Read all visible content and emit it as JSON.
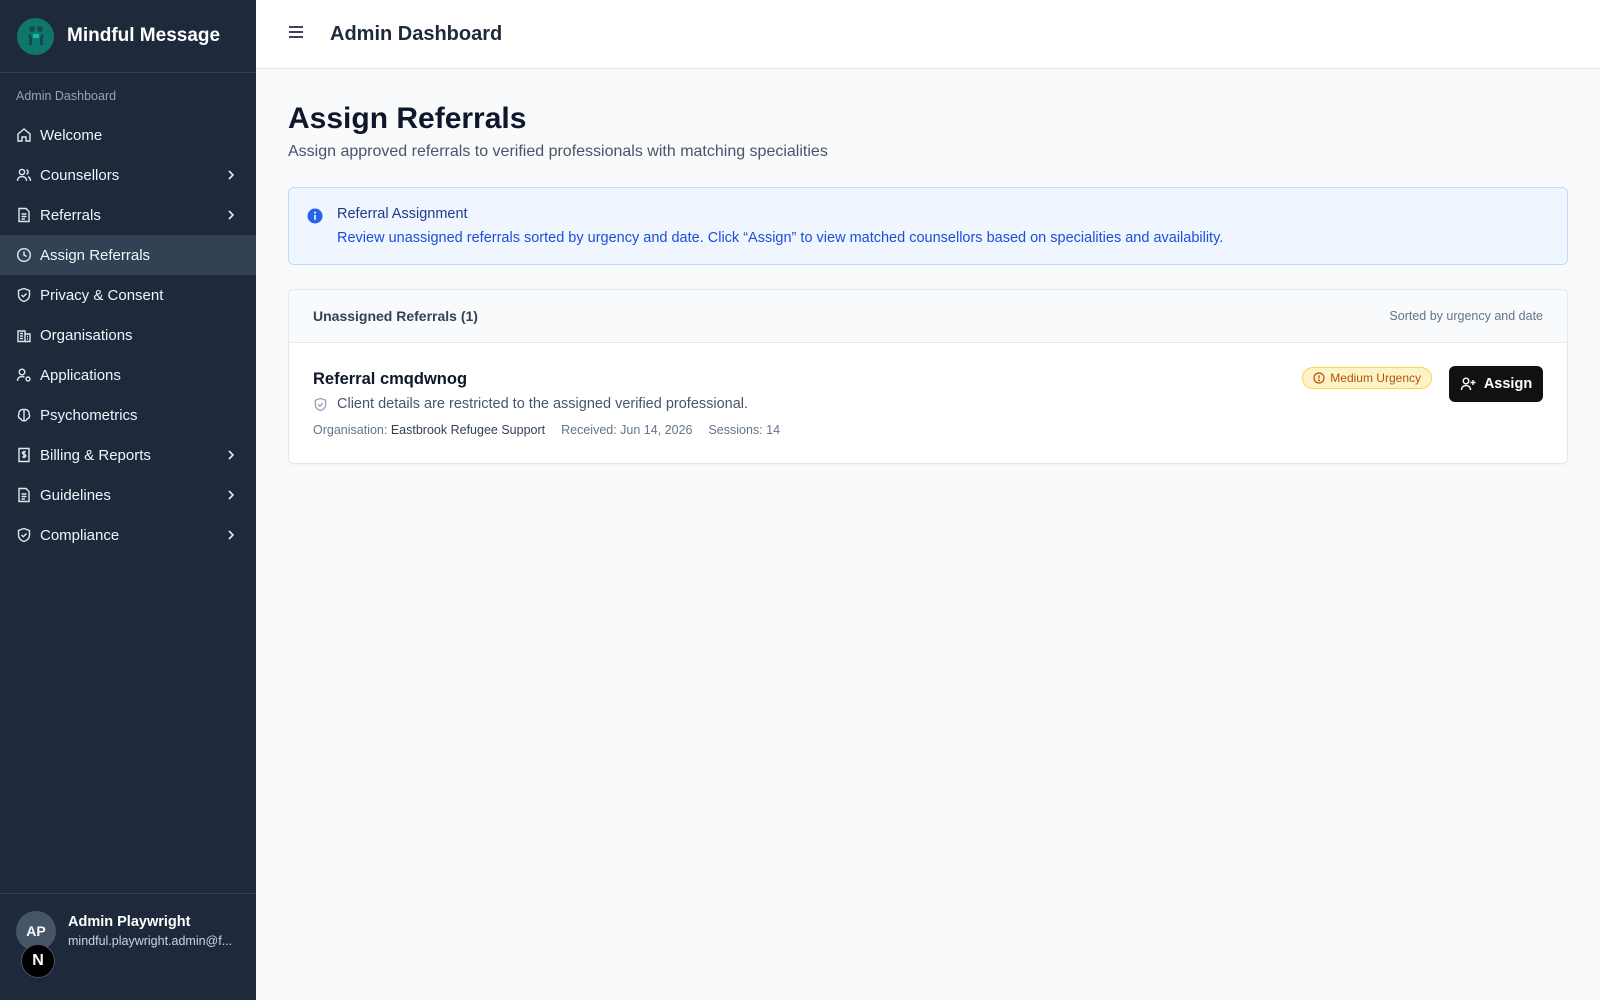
{
  "app": {
    "name": "Mindful Message"
  },
  "sidebar": {
    "section_label": "Admin Dashboard",
    "items": [
      {
        "label": "Welcome",
        "icon": "home-icon",
        "chevron": false,
        "active": false
      },
      {
        "label": "Counsellors",
        "icon": "users-icon",
        "chevron": true,
        "active": false
      },
      {
        "label": "Referrals",
        "icon": "file-text-icon",
        "chevron": true,
        "active": false
      },
      {
        "label": "Assign Referrals",
        "icon": "clock-icon",
        "chevron": false,
        "active": true
      },
      {
        "label": "Privacy & Consent",
        "icon": "shield-check-icon",
        "chevron": false,
        "active": false
      },
      {
        "label": "Organisations",
        "icon": "building-icon",
        "chevron": false,
        "active": false
      },
      {
        "label": "Applications",
        "icon": "user-cog-icon",
        "chevron": false,
        "active": false
      },
      {
        "label": "Psychometrics",
        "icon": "brain-icon",
        "chevron": false,
        "active": false
      },
      {
        "label": "Billing & Reports",
        "icon": "receipt-icon",
        "chevron": true,
        "active": false
      },
      {
        "label": "Guidelines",
        "icon": "file-text-icon",
        "chevron": true,
        "active": false
      },
      {
        "label": "Compliance",
        "icon": "shield-check-icon",
        "chevron": true,
        "active": false
      }
    ],
    "user": {
      "initials": "AP",
      "name": "Admin Playwright",
      "email": "mindful.playwright.admin@f..."
    },
    "dev_badge": "N"
  },
  "topbar": {
    "title": "Admin Dashboard"
  },
  "page": {
    "title": "Assign Referrals",
    "subtitle": "Assign approved referrals to verified professionals with matching specialities"
  },
  "info": {
    "title": "Referral Assignment",
    "text": "Review unassigned referrals sorted by urgency and date. Click “Assign” to view matched counsellors based on specialities and availability."
  },
  "referrals_card": {
    "header": "Unassigned Referrals (1)",
    "sort_note": "Sorted by urgency and date",
    "rows": [
      {
        "title": "Referral cmqdwnog",
        "restricted_note": "Client details are restricted to the assigned verified professional.",
        "org_label": "Organisation:",
        "org_value": "Eastbrook Refugee Support",
        "received": "Received: Jun 14, 2026",
        "sessions": "Sessions: 14",
        "urgency": "Medium Urgency",
        "assign_label": "Assign"
      }
    ]
  },
  "colors": {
    "sidebar_bg": "#1e293b",
    "active_item_bg": "#334155",
    "info_bg": "#eff6ff",
    "info_text": "#1d4ed8",
    "urgency_bg": "#fef3c7",
    "urgency_text": "#b45309",
    "button_bg": "#111111"
  }
}
